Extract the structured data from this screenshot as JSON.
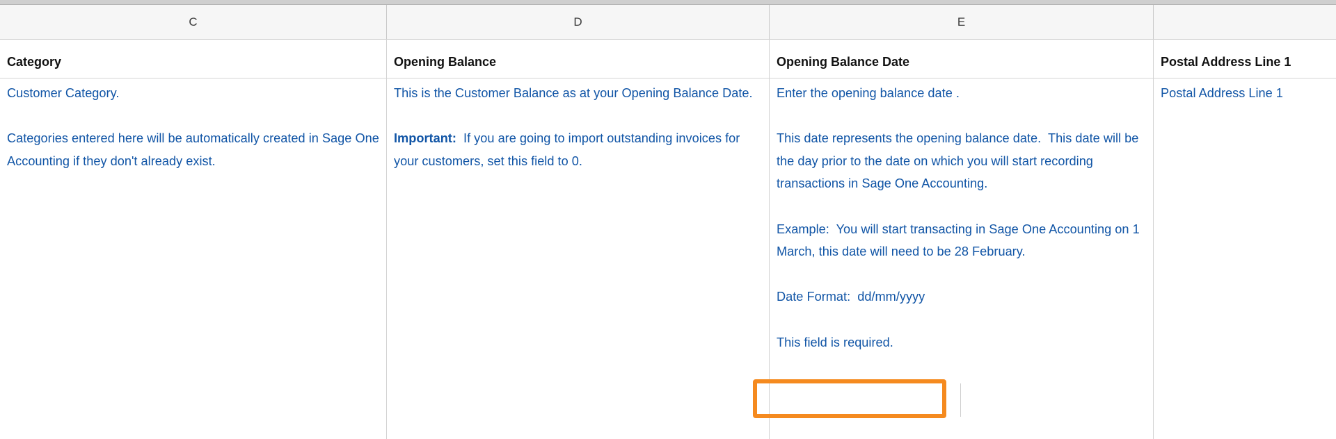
{
  "columns": {
    "c": "C",
    "d": "D",
    "e": "E",
    "f": ""
  },
  "headers": {
    "c": "Category",
    "d": "Opening Balance",
    "e": "Opening Balance Date",
    "f": "Postal Address Line 1"
  },
  "cells": {
    "c": {
      "p1": "Customer Category.",
      "p2": "Categories entered here will be automatically created in Sage One Accounting if they don't already exist."
    },
    "d": {
      "p1": "This is the Customer Balance as at your Opening Balance Date.",
      "p2_bold": "Important:",
      "p2_rest": "  If you are going to import outstanding invoices for your customers, set this field to 0."
    },
    "e": {
      "p1": "Enter the opening balance date .",
      "p2": "This date represents the opening balance date.  This date will be the day prior to the date on which you will start recording transactions in Sage One Accounting.",
      "p3": "Example:  You will start transacting in Sage One Accounting on 1 March, this date will need to be 28 February.",
      "p4": "Date Format:  dd/mm/yyyy",
      "p5": "This field is required."
    },
    "f": {
      "p1": "Postal Address Line 1"
    }
  },
  "colors": {
    "cell_text": "#1155a6",
    "highlight": "#f58a1f"
  }
}
